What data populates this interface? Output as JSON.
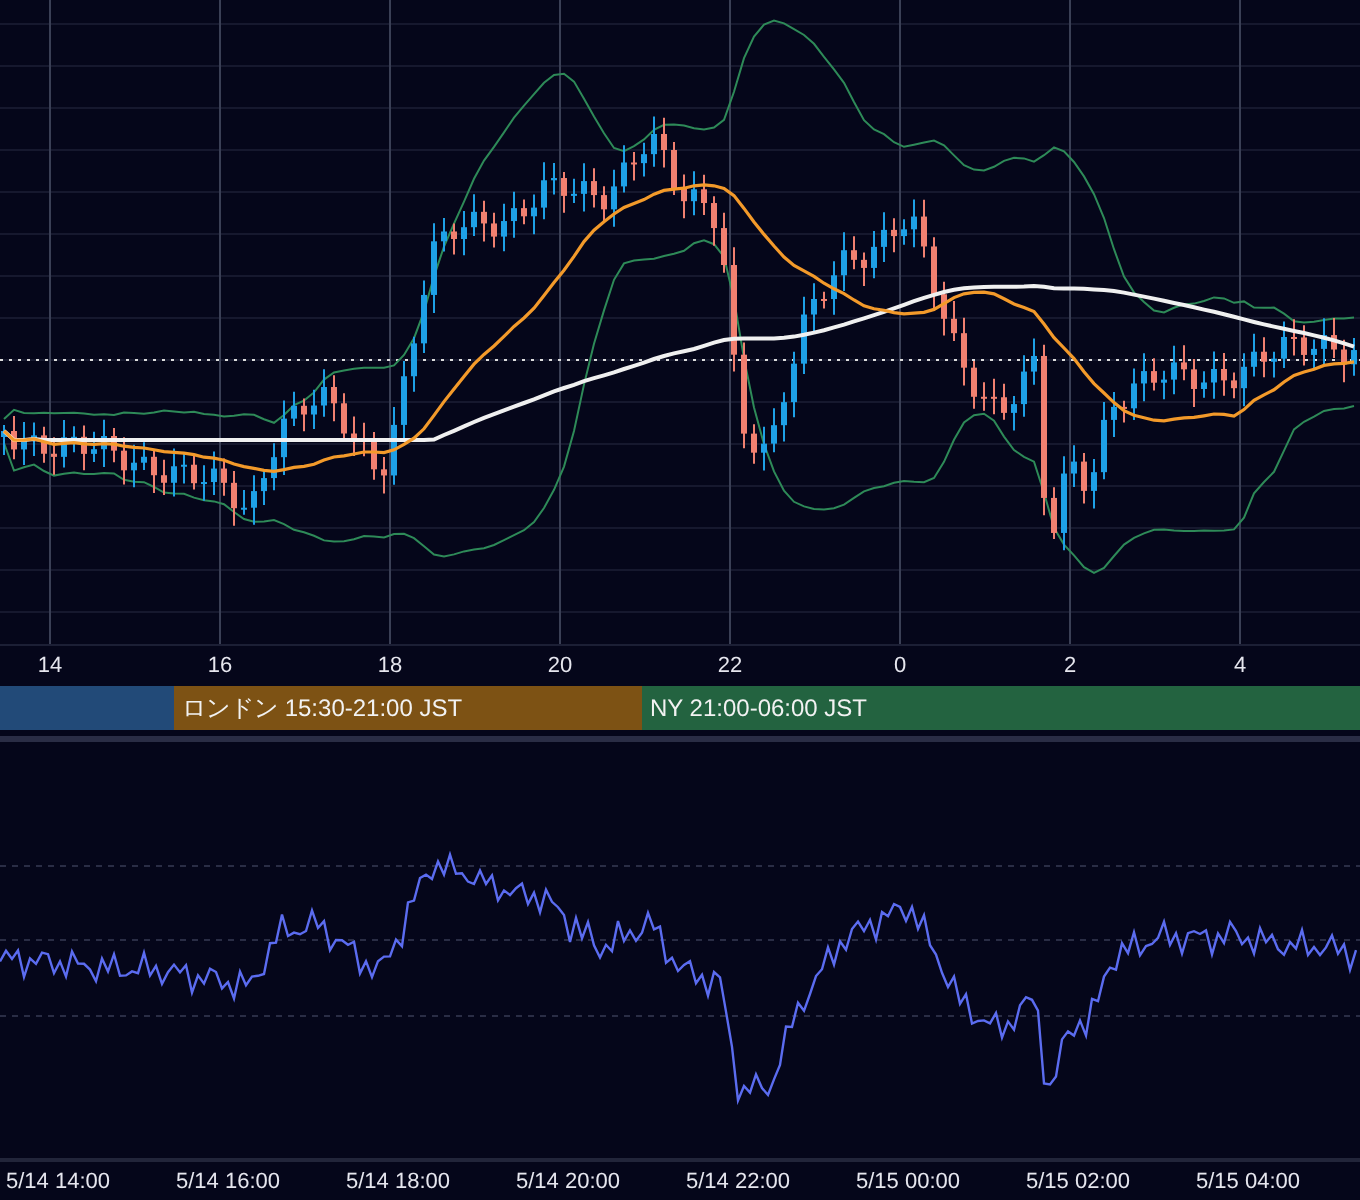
{
  "time_axis": [
    "14",
    "16",
    "18",
    "20",
    "22",
    "0",
    "2",
    "4"
  ],
  "sessions": [
    {
      "color": "#224a78"
    },
    {
      "label": "ロンドン 15:30-21:00 JST",
      "color": "#7d5214"
    },
    {
      "label": "NY 21:00-06:00 JST",
      "color": "#236340"
    }
  ],
  "date_axis": [
    "5/14 14:00",
    "5/14 16:00",
    "5/14 18:00",
    "5/14 20:00",
    "5/14 22:00",
    "5/15 00:00",
    "5/15 02:00",
    "5/15 04:00"
  ]
}
